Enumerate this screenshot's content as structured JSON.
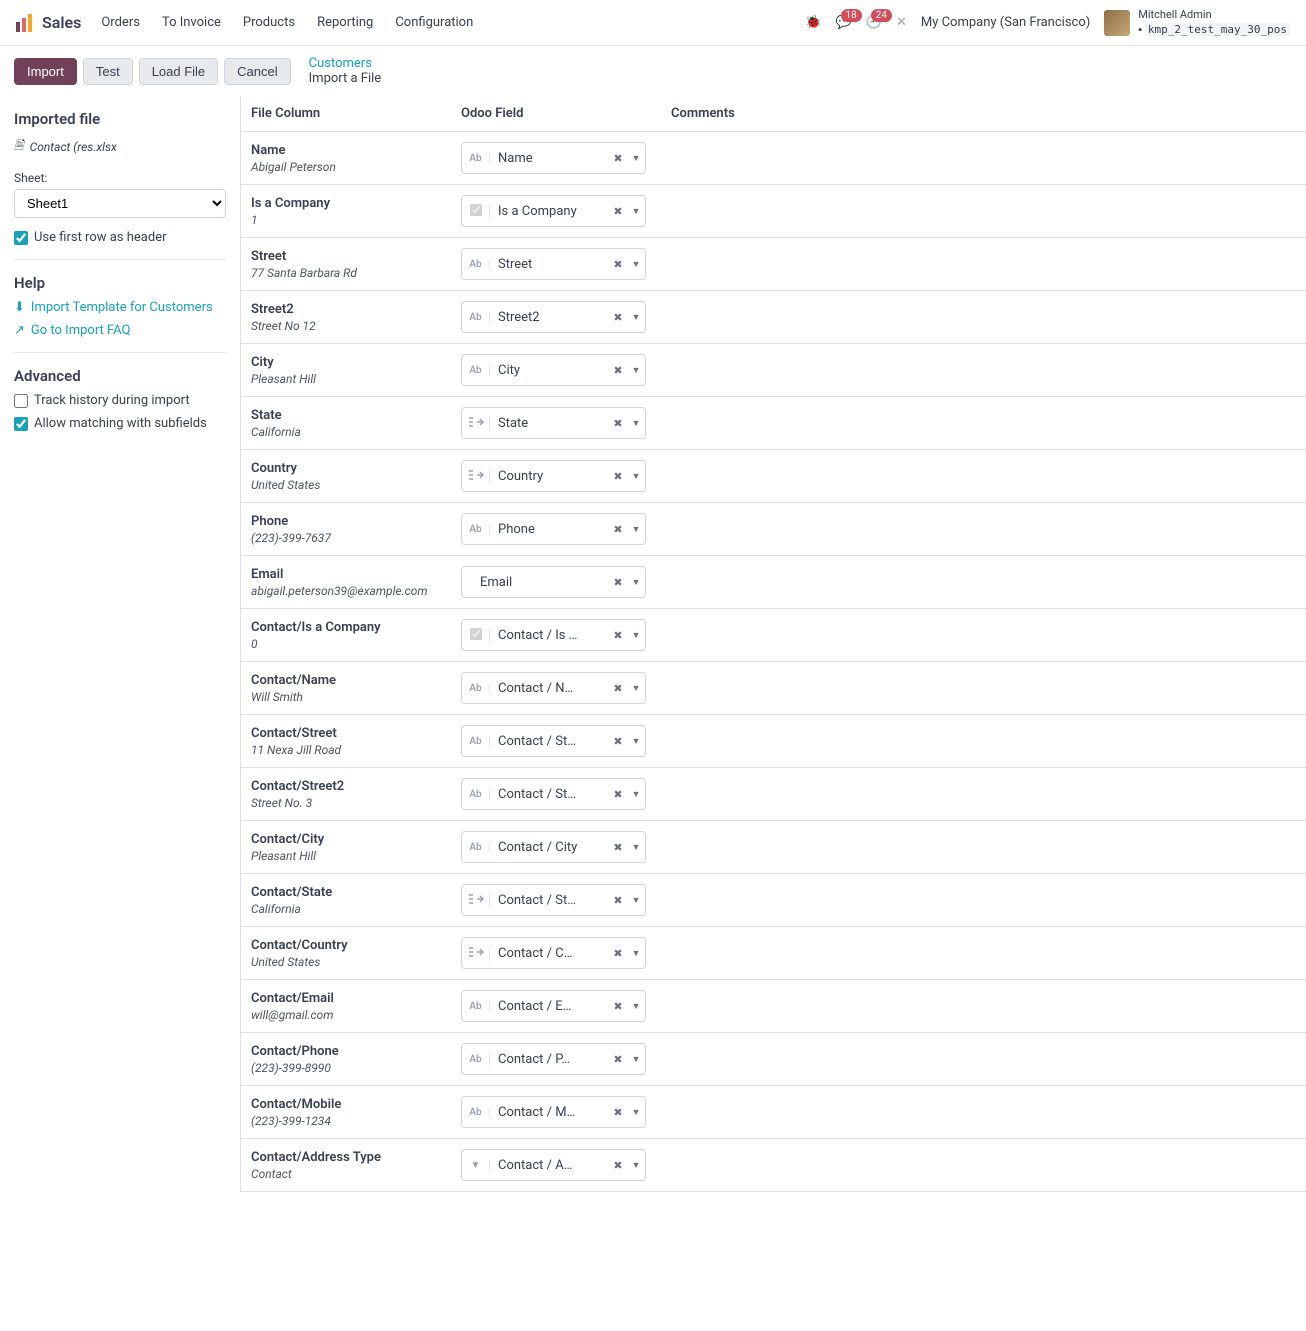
{
  "header": {
    "brand": "Sales",
    "nav": [
      "Orders",
      "To Invoice",
      "Products",
      "Reporting",
      "Configuration"
    ],
    "messages_count": "18",
    "activities_count": "24",
    "company": "My Company (San Francisco)",
    "user_name": "Mitchell Admin",
    "db_name": "kmp_2_test_may_30_pos"
  },
  "actions": {
    "import": "Import",
    "test": "Test",
    "load": "Load File",
    "cancel": "Cancel",
    "breadcrumb_parent": "Customers",
    "breadcrumb_current": "Import a File"
  },
  "sidebar": {
    "imported_title": "Imported file",
    "file_name": "Contact (res.xlsx",
    "sheet_label": "Sheet:",
    "sheet_value": "Sheet1",
    "first_row_label": "Use first row as header",
    "help_title": "Help",
    "template_link": "Import Template for Customers",
    "faq_link": "Go to Import FAQ",
    "advanced_title": "Advanced",
    "track_label": "Track history during import",
    "subfields_label": "Allow matching with subfields"
  },
  "columns": {
    "file_column": "File Column",
    "odoo_field": "Odoo Field",
    "comments": "Comments"
  },
  "rows": [
    {
      "title": "Name",
      "sample": "Abigail Peterson",
      "type": "Ab",
      "field": "Name"
    },
    {
      "title": "Is a Company",
      "sample": "1",
      "type": "chk",
      "field": "Is a Company"
    },
    {
      "title": "Street",
      "sample": "77 Santa Barbara Rd",
      "type": "Ab",
      "field": "Street"
    },
    {
      "title": "Street2",
      "sample": "Street No 12",
      "type": "Ab",
      "field": "Street2"
    },
    {
      "title": "City",
      "sample": "Pleasant Hill",
      "type": "Ab",
      "field": "City"
    },
    {
      "title": "State",
      "sample": "California",
      "type": "rel",
      "field": "State"
    },
    {
      "title": "Country",
      "sample": "United States",
      "type": "rel",
      "field": "Country"
    },
    {
      "title": "Phone",
      "sample": "(223)-399-7637",
      "type": "Ab",
      "field": "Phone"
    },
    {
      "title": "Email",
      "sample": "abigail.peterson39@example.com",
      "type": "none",
      "field": "Email"
    },
    {
      "title": "Contact/Is a Company",
      "sample": "0",
      "type": "chk",
      "field": "Contact / Is …"
    },
    {
      "title": "Contact/Name",
      "sample": "Will Smith",
      "type": "Ab",
      "field": "Contact / N…"
    },
    {
      "title": "Contact/Street",
      "sample": "11 Nexa Jill Road",
      "type": "Ab",
      "field": "Contact / St…"
    },
    {
      "title": "Contact/Street2",
      "sample": "Street No. 3",
      "type": "Ab",
      "field": "Contact / St…"
    },
    {
      "title": "Contact/City",
      "sample": "Pleasant Hill",
      "type": "Ab",
      "field": "Contact / City"
    },
    {
      "title": "Contact/State",
      "sample": "California",
      "type": "rel",
      "field": "Contact / St…"
    },
    {
      "title": "Contact/Country",
      "sample": "United States",
      "type": "rel",
      "field": "Contact / C…"
    },
    {
      "title": "Contact/Email",
      "sample": "will@gmail.com",
      "type": "Ab",
      "field": "Contact / E…"
    },
    {
      "title": "Contact/Phone",
      "sample": "(223)-399-8990",
      "type": "Ab",
      "field": "Contact / P…"
    },
    {
      "title": "Contact/Mobile",
      "sample": "(223)-399-1234",
      "type": "Ab",
      "field": "Contact / M…"
    },
    {
      "title": "Contact/Address Type",
      "sample": "Contact",
      "type": "sel",
      "field": "Contact / A…"
    }
  ]
}
